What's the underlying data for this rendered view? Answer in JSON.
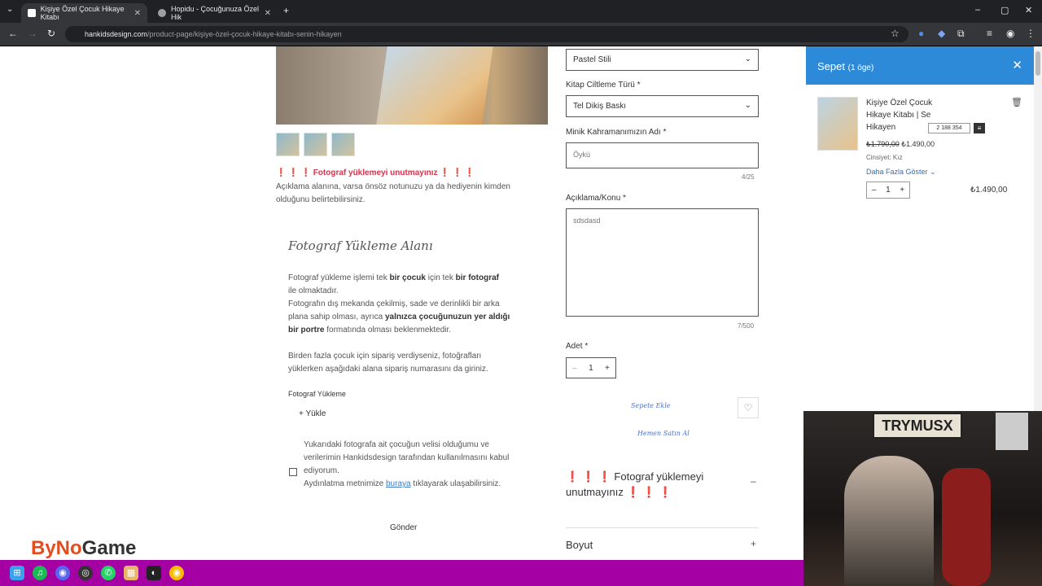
{
  "browser": {
    "tabs": [
      {
        "label": "Kişiye Özel Çocuk Hikaye Kitabı"
      },
      {
        "label": "Hopidu - Çocuğunuza Özel Hik"
      }
    ],
    "url_host": "hankidsdesign.com",
    "url_path": "/product-page/kişiye-özel-çocuk-hikaye-kitabı-senin-hikayen"
  },
  "page": {
    "warning_line": "❗ ❗ ❗ Fotograf yüklemeyi unutmayınız ❗ ❗ ❗",
    "note_line1": "Açıklama alanına, varsa önsöz notunuzu ya da hediyenin kimden",
    "note_line2": "olduğunu belirtebilirsiniz.",
    "upload_section_title": "Fotograf Yükleme Alanı",
    "p1_a": "Fotograf yükleme işlemi tek ",
    "p1_b": "bir çocuk",
    "p1_c": " için tek ",
    "p1_d": "bir fotograf",
    "p1_e": "ile olmaktadır.",
    "p2_a": "Fotografın dış mekanda çekilmiş, sade ve derinlikli bir arka",
    "p2_b": "plana sahip olması, ayrıca ",
    "p2_c": "yalnızca çocuğunuzun yer aldığı",
    "p2_d": "bir portre",
    "p2_e": " formatında olması beklenmektedir.",
    "p3_a": "Birden fazla çocuk için sipariş verdiyseniz, fotoğrafları",
    "p3_b": "yüklerken aşağıdaki alana sipariş numarasını da giriniz.",
    "upload_label": "Fotograf Yükleme",
    "upload_button": "Yükle",
    "consent_a": "Yukarıdaki fotografa ait çocuğun velisi olduğumu ve verilerimin Hankidsdesign tarafından kullanılmasını kabul ediyorum.",
    "consent_b": "Aydınlatma metnimize ",
    "consent_link": "buraya",
    "consent_c": " tıklayarak ulaşabilirsiniz.",
    "submit": "Gönder",
    "logo_a": "ByNo",
    "logo_b": "Game"
  },
  "form": {
    "style_value": "Pastel Stili",
    "binding_label": "Kitap Ciltleme Türü *",
    "binding_value": "Tel Dikiş Baskı",
    "hero_label": "Minik Kahramanımızın Adı *",
    "hero_value": "Öykü",
    "hero_counter": "4/25",
    "desc_label": "Açıklama/Konu *",
    "desc_value": "sdsdasd",
    "desc_counter": "7/500",
    "qty_label": "Adet *",
    "qty_value": "1",
    "add_to_cart": "Sepete Ekle",
    "buy_now": "Hemen Satın Al",
    "acc1_a": "❗ ❗ ❗ ",
    "acc1_b": "Fotograf yüklemeyi",
    "acc1_c": "unutmayınız",
    "acc1_d": " ❗ ❗ ❗",
    "acc2": "Boyut"
  },
  "cart": {
    "title": "Sepet",
    "count": "(1 öge)",
    "item_name_1": "Kişiye Özel Çocuk",
    "item_name_2": "Hikaye Kitabı | Se",
    "item_name_3": "Hikayen",
    "old_price": "₺1.790,00",
    "price": "₺1.490,00",
    "attr": "Cinsiyet: Kız",
    "more": "Daha Fazla Göster",
    "qty": "1",
    "total": "₺1.490,00",
    "badge": "2 188 354"
  },
  "webcam": {
    "sign": "TRYMUSX"
  }
}
